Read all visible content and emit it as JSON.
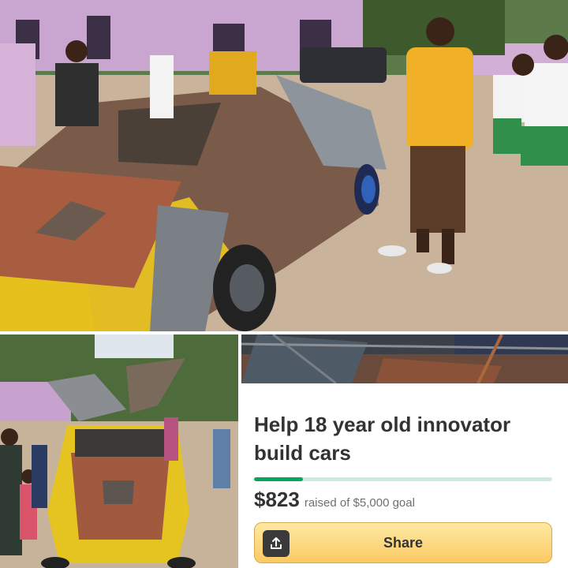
{
  "campaign": {
    "title": "Help 18 year old innovator build cars",
    "raised": "$823",
    "raised_text": "raised of $5,000 goal",
    "progress_fraction": 0.1646
  },
  "share_button": {
    "label": "Share",
    "icon": "share-upload-icon"
  },
  "colors": {
    "progress_fill": "#02a95c",
    "progress_track": "#c9eee1",
    "button_top": "#fde9a3",
    "button_bottom": "#fbc963",
    "title_text": "#333333"
  },
  "photos": {
    "top": "student standing beside handmade car with open hood",
    "bottom_left": "crowd around handmade car with gull-wing doors open",
    "bottom_right": "car frame interior close-up"
  }
}
